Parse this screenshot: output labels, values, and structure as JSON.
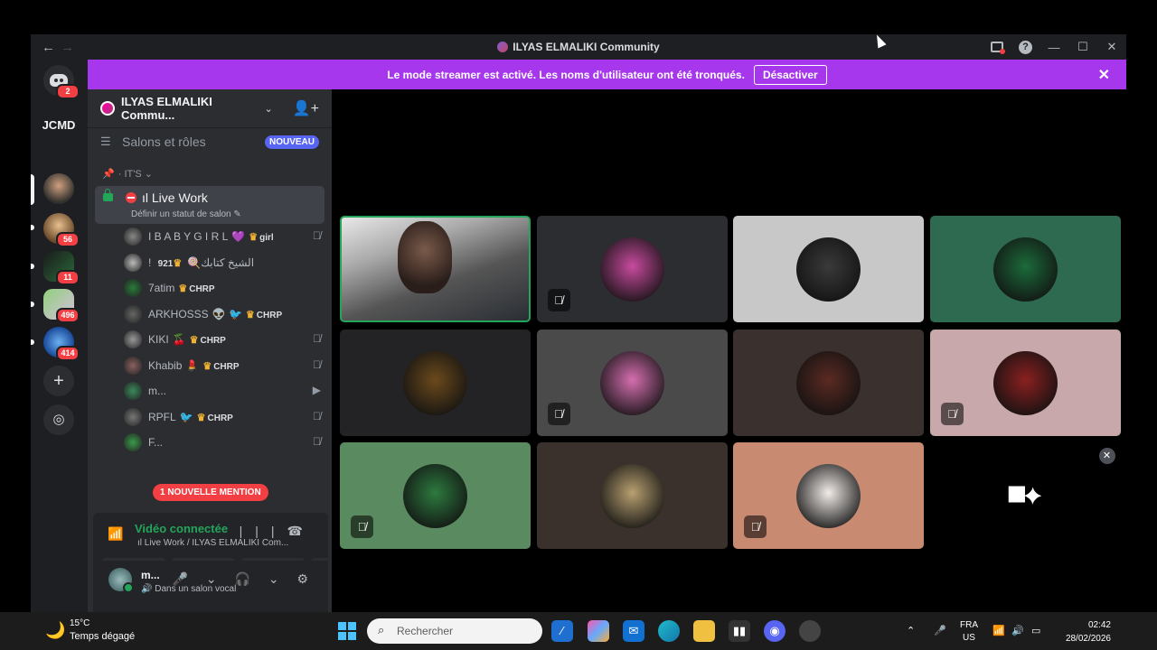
{
  "window": {
    "title": "ILYAS ELMALIKI Community",
    "nav_back": "←",
    "nav_forward": "→",
    "help": "?",
    "minimize": "—",
    "maximize": "☐",
    "close": "✕"
  },
  "banner": {
    "message": "Le mode streamer est activé. Les noms d'utilisateur ont été tronqués.",
    "button_label": "Désactiver",
    "close": "✕"
  },
  "guilds": [
    {
      "name": "home",
      "badge": "2"
    },
    {
      "name": "JCMD",
      "badge": ""
    },
    {
      "name": "server-1",
      "badge": ""
    },
    {
      "name": "server-2",
      "badge": "56"
    },
    {
      "name": "server-3",
      "badge": "11"
    },
    {
      "name": "server-4",
      "badge": "496"
    },
    {
      "name": "server-5",
      "badge": "414"
    }
  ],
  "guild_text": "JCMD",
  "guild_add": "+",
  "guild_explore": "◎",
  "server": {
    "name": "ILYAS ELMALIKI Commu...",
    "chevron": "⌄",
    "invite_icon": "👤+"
  },
  "roles_row": {
    "label": "Salons et rôles",
    "badge": "NOUVEAU"
  },
  "category": {
    "label": "IT'S"
  },
  "voice_channel": {
    "name": "Live Work",
    "status": "Définir un statut de salon"
  },
  "members": [
    {
      "name": "I B A B Y G I R L",
      "emoji": "💜",
      "tag": "girl",
      "muted": true
    },
    {
      "name": "! الشيخ كتابك",
      "emoji": "🍭",
      "tag": "921",
      "muted": false
    },
    {
      "name": "7atim",
      "emoji": "",
      "tag": "CHRP",
      "muted": false
    },
    {
      "name": "ARKHOSSS",
      "emoji": "👽 🐦",
      "tag": "CHRP",
      "muted": false
    },
    {
      "name": "KIKI",
      "emoji": "🍒",
      "tag": "CHRP",
      "muted": true
    },
    {
      "name": "Khabib",
      "emoji": "💄",
      "tag": "CHRP",
      "muted": true
    },
    {
      "name": "m...",
      "emoji": "",
      "tag": "",
      "muted": false
    },
    {
      "name": "RPFL",
      "emoji": "🐦",
      "tag": "CHRP",
      "muted": true
    },
    {
      "name": "F...",
      "emoji": "",
      "tag": "",
      "muted": true
    }
  ],
  "mention_pill": "1 NOUVELLE MENTION",
  "voice_panel": {
    "title": "Vidéo connectée",
    "location": "ıl Live Work / ILYAS ELMALIKI Com...",
    "buttons": [
      "▶",
      "⇪",
      "⁘",
      "✦"
    ]
  },
  "user": {
    "name": "m...",
    "status": "Dans un salon vocal",
    "controls": "🎤 ⌄ 🎧 ⌄ ⚙"
  },
  "tiles": [
    {
      "bg": "#3a3f44",
      "pfp": "camera",
      "muted": false,
      "active": true
    },
    {
      "bg": "#2b2d31",
      "pfp": "#c84b9e",
      "muted": true
    },
    {
      "bg": "#c8c8c8",
      "pfp": "#3a3a3a",
      "muted": false
    },
    {
      "bg": "#2e6a50",
      "pfp": "#1c6b3b",
      "muted": false
    },
    {
      "bg": "#232326",
      "pfp": "#6b4a1c",
      "muted": false
    },
    {
      "bg": "#4a4a4a",
      "pfp": "#d56fb0",
      "muted": true
    },
    {
      "bg": "#3a302e",
      "pfp": "#5b2a22",
      "muted": false
    },
    {
      "bg": "#c8a8ab",
      "pfp": "#8b2020",
      "muted": true
    },
    {
      "bg": "#5a8a60",
      "pfp": "#2d7a3f",
      "muted": true
    },
    {
      "bg": "#3a302c",
      "pfp": "#b8a070",
      "muted": false
    },
    {
      "bg": "#c98a72",
      "pfp": "#f2ece8",
      "muted": true
    },
    {
      "bg": "#000000",
      "pfp": "apps",
      "muted": false
    }
  ],
  "apps_icon": "⯀✦",
  "tile_close": "✕",
  "taskbar": {
    "temperature": "15°C",
    "weather": "Temps dégagé",
    "search_placeholder": "Rechercher",
    "lang_top": "FRA",
    "lang_bottom": "US",
    "time": "02:42",
    "date": "28/02/2026"
  }
}
